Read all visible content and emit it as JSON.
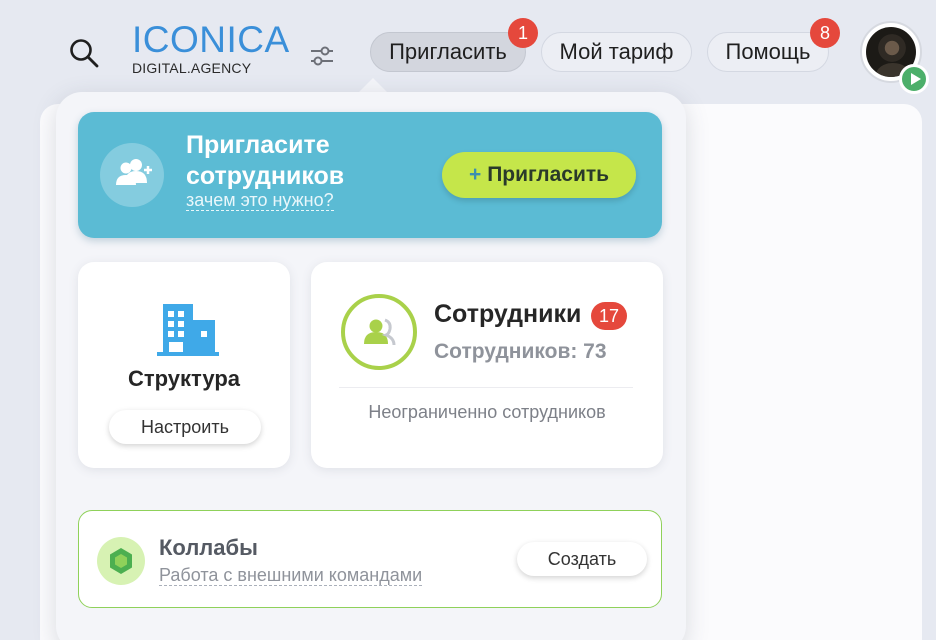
{
  "header": {
    "logo": {
      "main": "ICONICA",
      "sub": "DIGITAL.AGENCY"
    },
    "nav": [
      {
        "label": "Пригласить",
        "badge": "1",
        "active": true
      },
      {
        "label": "Мой тариф"
      },
      {
        "label": "Помощь",
        "badge": "8"
      }
    ],
    "icons": {
      "search": "search-icon",
      "filters": "sliders-icon",
      "status": "play-icon"
    }
  },
  "dropdown": {
    "invite": {
      "title": "Пригласите сотрудников",
      "link": "зачем это нужно?",
      "button": "Пригласить",
      "button_icon": "+"
    },
    "structure": {
      "title": "Структура",
      "button": "Настроить"
    },
    "employees": {
      "title": "Сотрудники",
      "badge": "17",
      "count": "Сотрудников: 73",
      "limit": "Неограниченно сотрудников"
    },
    "collabs": {
      "title": "Коллабы",
      "subtitle": "Работа с внешними командами",
      "button": "Создать"
    }
  },
  "colors": {
    "accent": "#5bbbd4",
    "invite_button": "#c5e64a",
    "badge": "#e5483c",
    "logo": "#3a8fd9",
    "building": "#3fa9e8",
    "employees_ring": "#a9d14a",
    "collab_border": "#8fd15a"
  }
}
